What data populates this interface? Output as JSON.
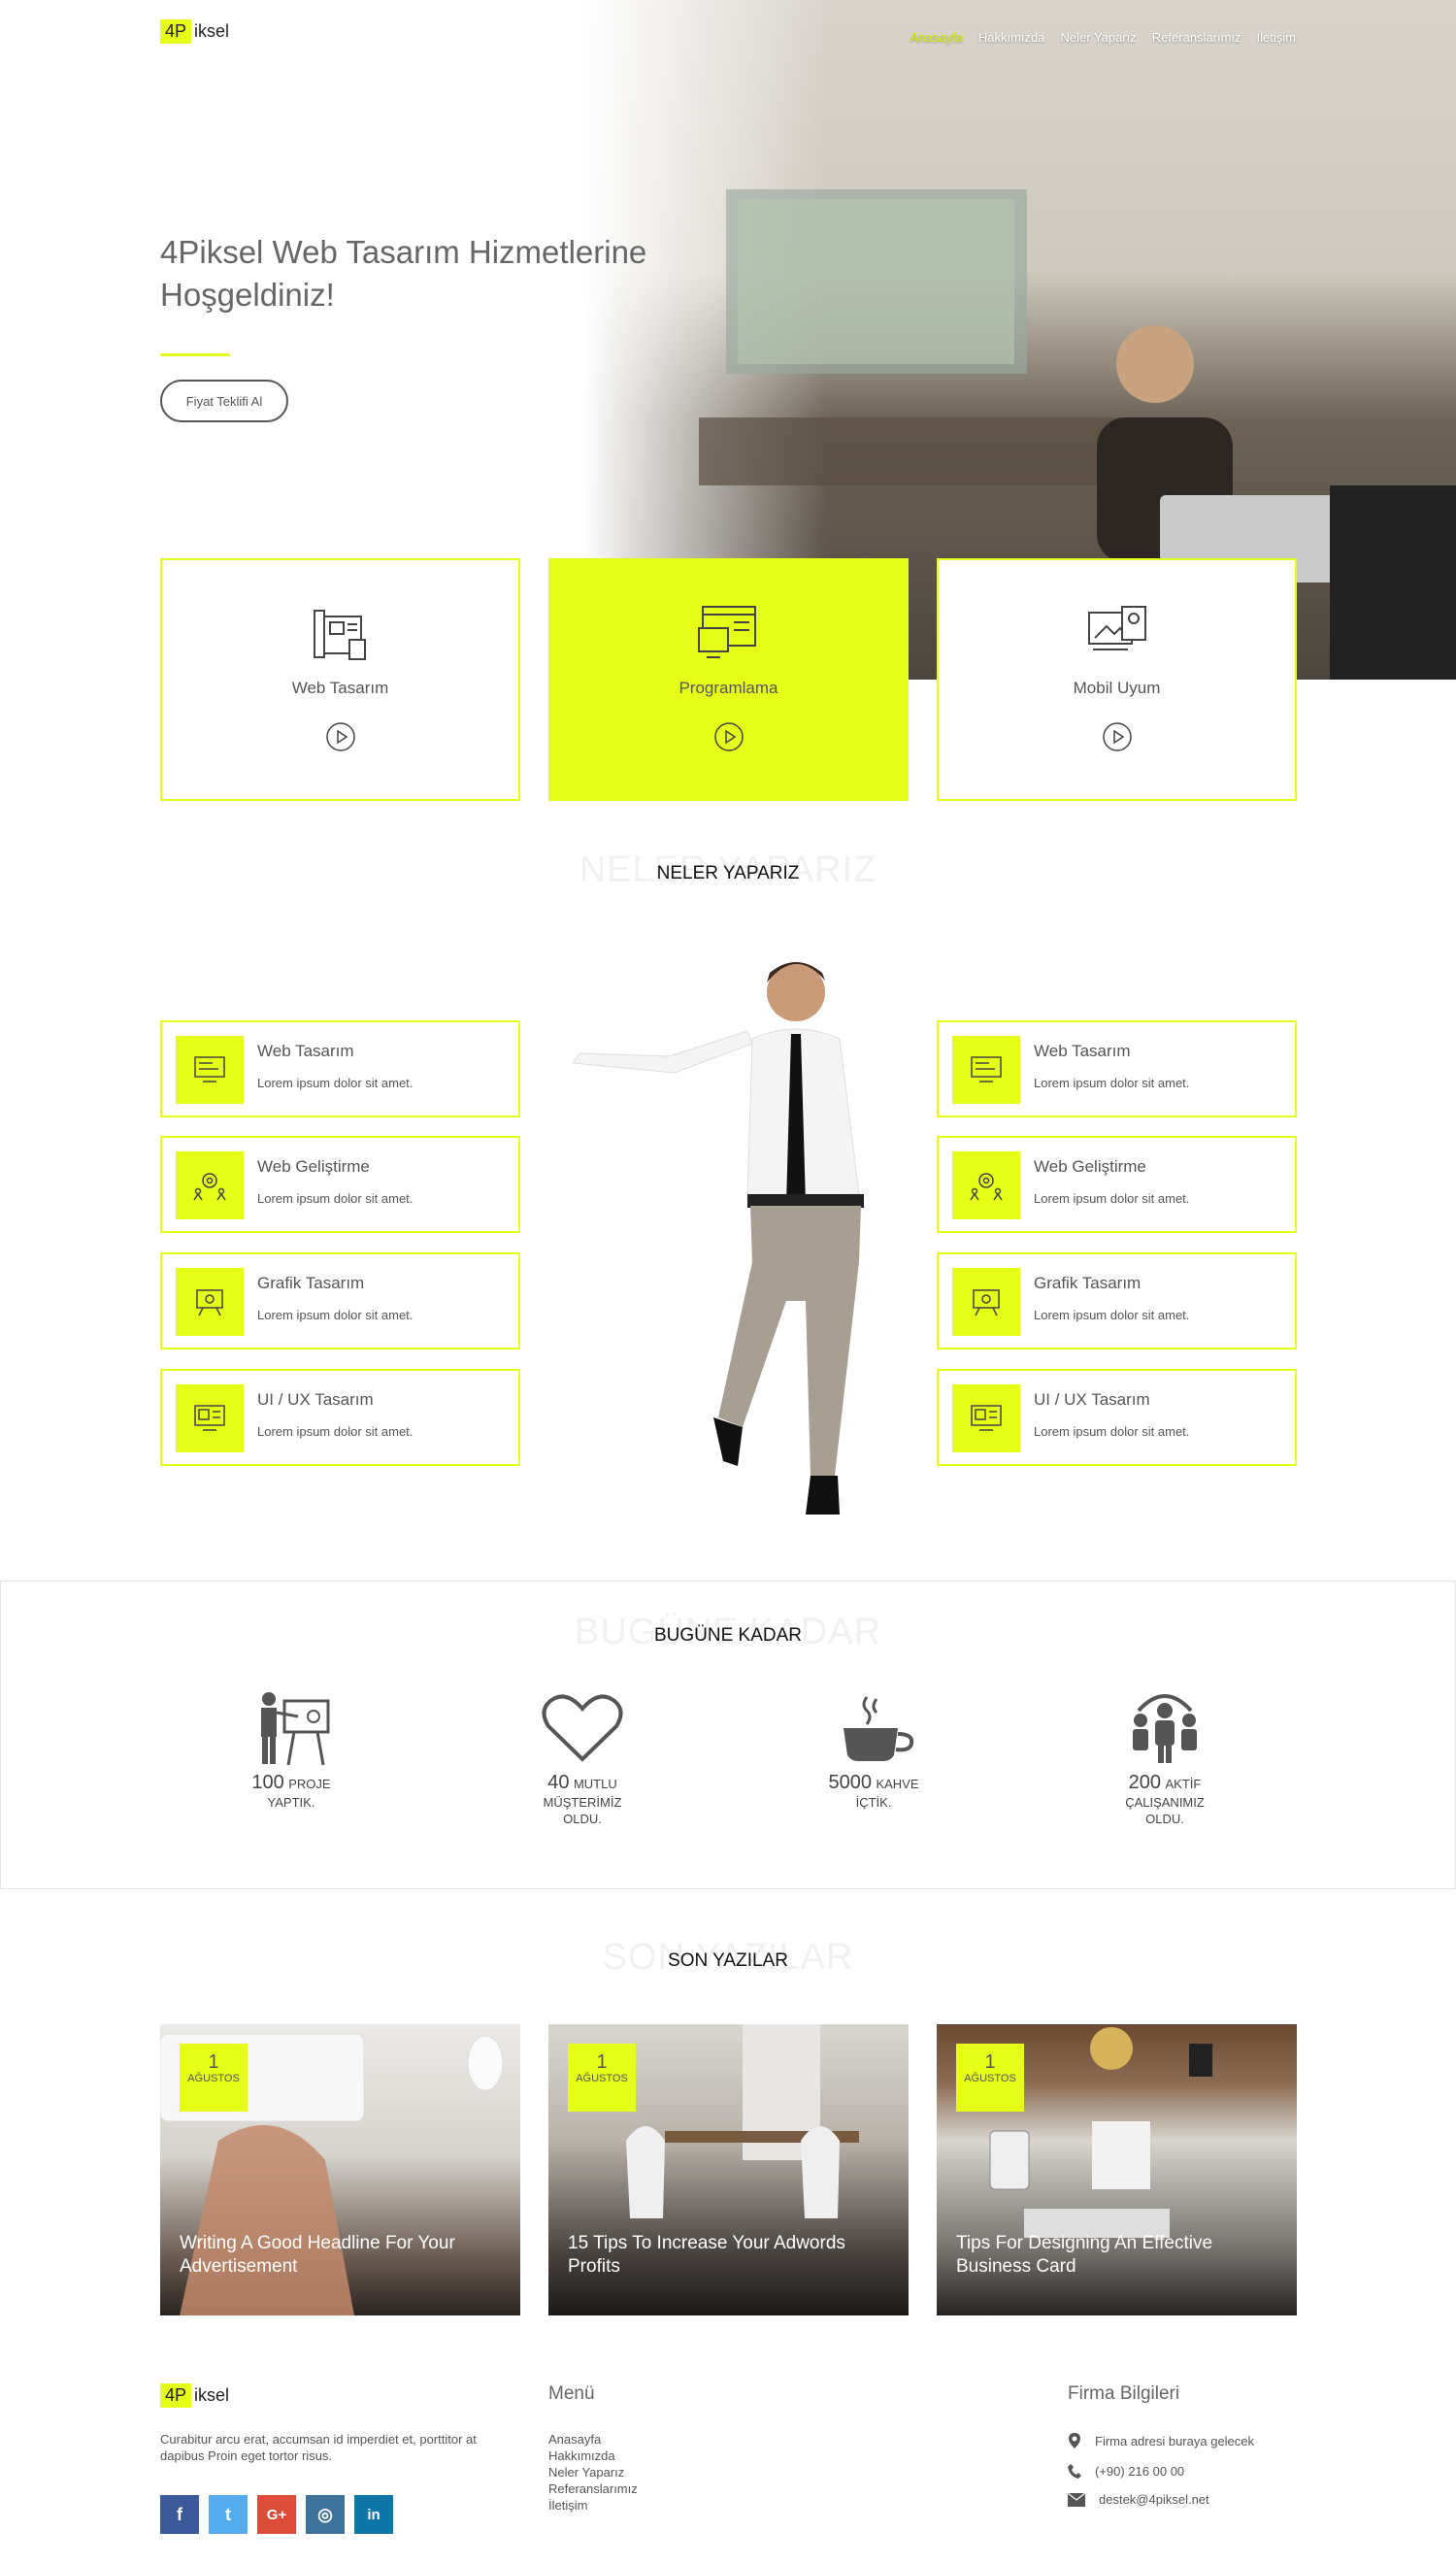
{
  "brand": {
    "logo_box": "4P",
    "logo_rest": "iksel",
    "accent": "#e6ff17"
  },
  "nav": {
    "items": [
      {
        "label": "Anasayfa",
        "active": true
      },
      {
        "label": "Hakkımızda"
      },
      {
        "label": "Neler Yaparız"
      },
      {
        "label": "Referanslarımız"
      },
      {
        "label": "İletişim"
      }
    ]
  },
  "hero": {
    "title_line1": "4Piksel Web Tasarım Hizmetlerine",
    "title_line2": "Hoşgeldiniz!",
    "cta": "Fiyat Teklifi Al"
  },
  "services": [
    {
      "label": "Web Tasarım",
      "icon": "blueprint-icon"
    },
    {
      "label": "Programlama",
      "icon": "code-window-icon",
      "active": true
    },
    {
      "label": "Mobil Uyum",
      "icon": "responsive-devices-icon"
    }
  ],
  "what_we_do": {
    "ghost": "NELER YAPARIZ",
    "title": "NELER YAPARIZ",
    "items": [
      {
        "title": "Web Tasarım",
        "desc": "Lorem ipsum dolor sit amet.",
        "icon": "monitor-icon"
      },
      {
        "title": "Web Geliştirme",
        "desc": "Lorem ipsum dolor sit amet.",
        "icon": "gear-people-icon"
      },
      {
        "title": "Grafik Tasarım",
        "desc": "Lorem ipsum dolor sit amet.",
        "icon": "design-board-icon"
      },
      {
        "title": "UI / UX Tasarım",
        "desc": "Lorem ipsum dolor sit amet.",
        "icon": "ui-screen-icon"
      }
    ]
  },
  "counters": {
    "ghost": "BUGÜNE KADAR",
    "title": "BUGÜNE KADAR",
    "items": [
      {
        "num": "100",
        "first": "PROJE",
        "rest": "YAPTIK.",
        "icon": "presentation-icon"
      },
      {
        "num": "40",
        "first": "MUTLU",
        "rest": "MÜŞTERİMİZ OLDU.",
        "icon": "heart-icon"
      },
      {
        "num": "5000",
        "first": "KAHVE",
        "rest": "İÇTİK.",
        "icon": "coffee-cup-icon"
      },
      {
        "num": "200",
        "first": "AKTİF",
        "rest": "ÇALIŞANIMIZ OLDU.",
        "icon": "team-icon"
      }
    ]
  },
  "blog": {
    "ghost": "SON YAZILAR",
    "title": "SON YAZILAR",
    "posts": [
      {
        "day": "1",
        "month": "AĞUSTOS",
        "title": "Writing A Good Headline For Your Advertisement"
      },
      {
        "day": "1",
        "month": "AĞUSTOS",
        "title": "15 Tips To Increase Your Adwords Profits"
      },
      {
        "day": "1",
        "month": "AĞUSTOS",
        "title": "Tips For Designing An Effective Business Card"
      }
    ]
  },
  "footer": {
    "about": "Curabitur arcu erat, accumsan id imperdiet et, porttitor at dapibus Proin eget tortor risus.",
    "menu_title": "Menü",
    "menu": [
      "Anasayfa",
      "Hakkımızda",
      "Neler Yaparız",
      "Referanslarımız",
      "İletişim"
    ],
    "info_title": "Firma Bilgileri",
    "address": "Firma adresi buraya gelecek",
    "phone": "(+90) 216 00 00",
    "email": "destek@4piksel.net",
    "social": [
      {
        "name": "facebook",
        "glyph": "f",
        "color": "#3b5998"
      },
      {
        "name": "twitter",
        "glyph": "t",
        "color": "#55acee"
      },
      {
        "name": "google-plus",
        "glyph": "G+",
        "color": "#dd4b39"
      },
      {
        "name": "instagram",
        "glyph": "◎",
        "color": "#3f729b"
      },
      {
        "name": "linkedin",
        "glyph": "in",
        "color": "#0e76a8"
      }
    ]
  }
}
